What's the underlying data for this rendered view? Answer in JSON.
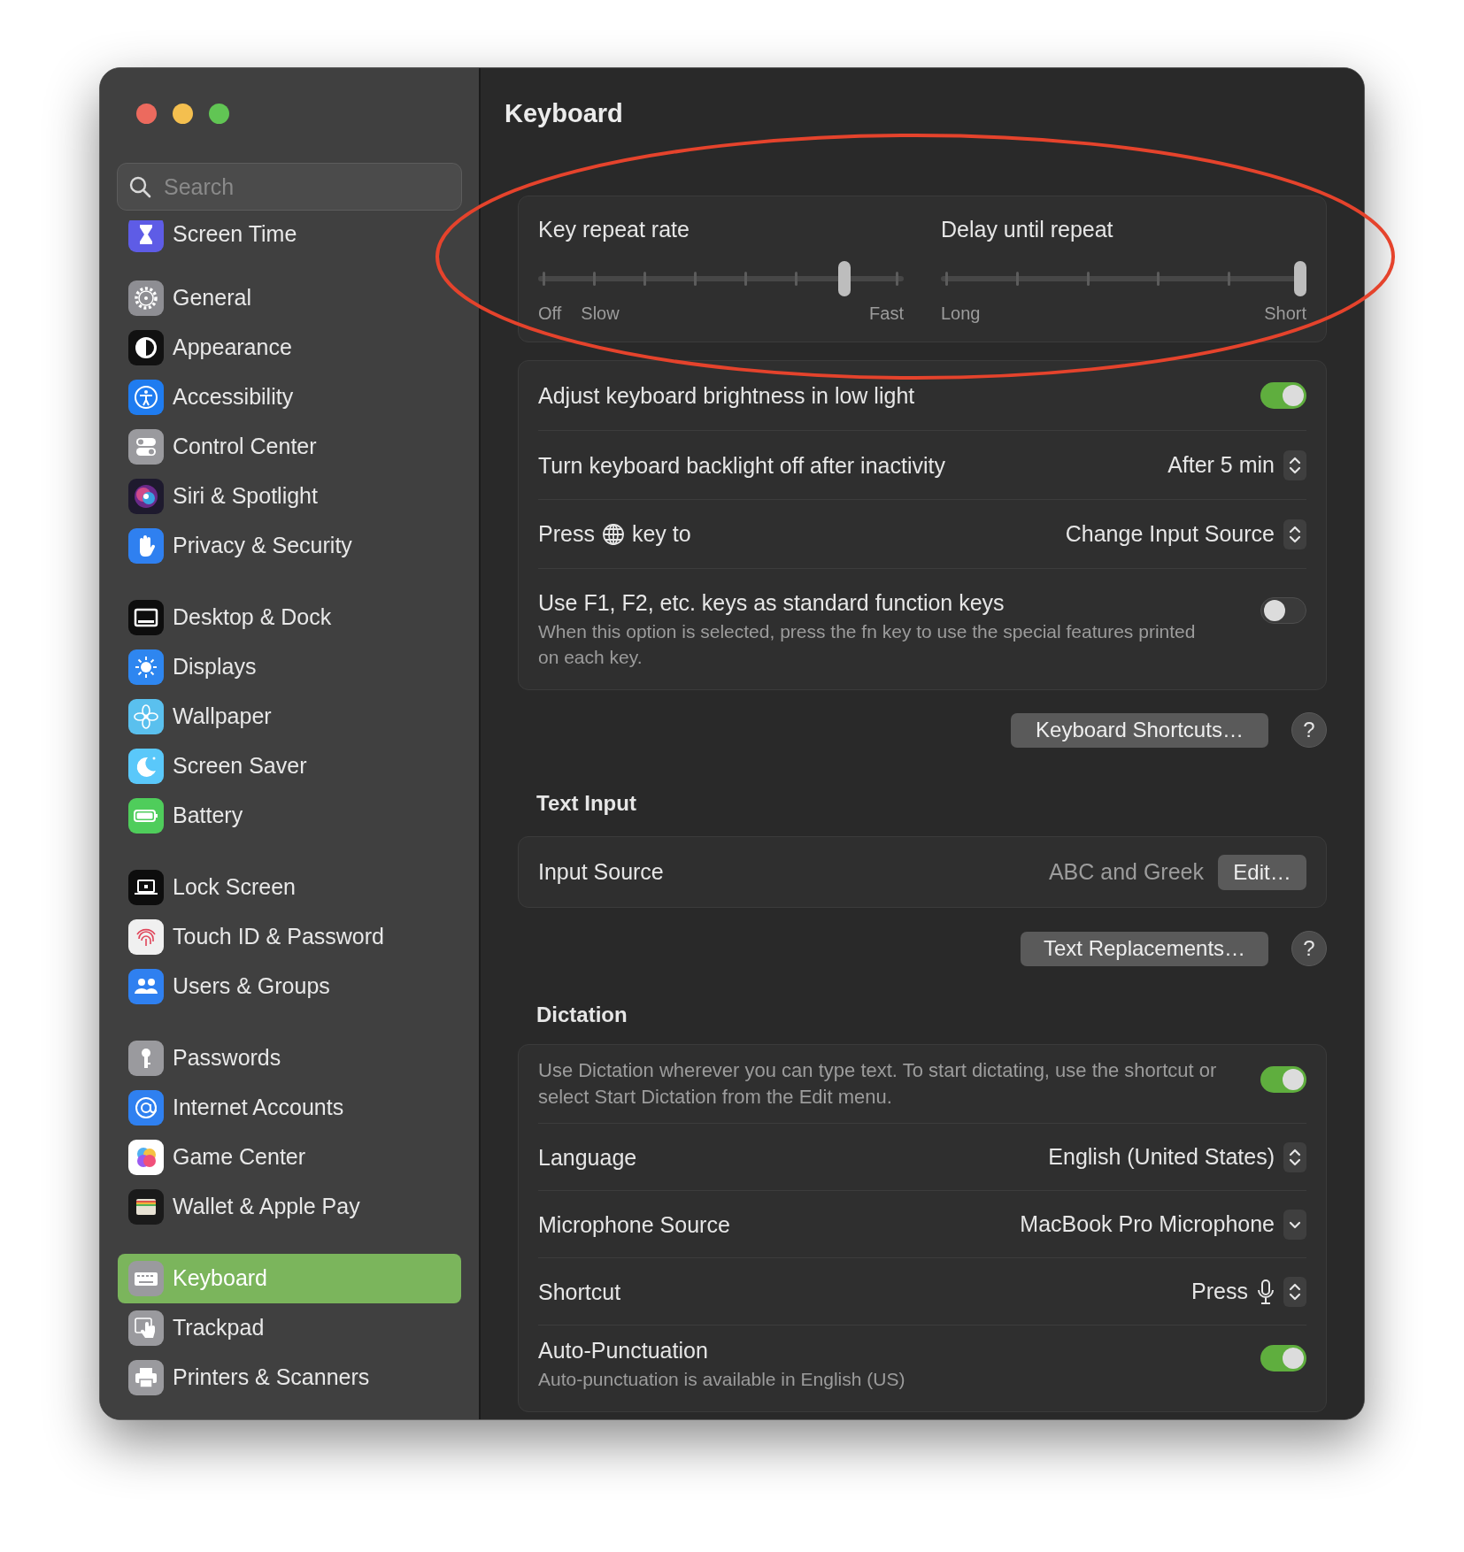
{
  "window": {
    "title": "Keyboard"
  },
  "sidebar": {
    "search": {
      "placeholder": "Search"
    },
    "groups": [
      {
        "items": [
          {
            "label": "Screen Time",
            "selected": false
          }
        ]
      },
      {
        "items": [
          {
            "label": "General",
            "selected": false
          },
          {
            "label": "Appearance",
            "selected": false
          },
          {
            "label": "Accessibility",
            "selected": false
          },
          {
            "label": "Control Center",
            "selected": false
          },
          {
            "label": "Siri & Spotlight",
            "selected": false
          },
          {
            "label": "Privacy & Security",
            "selected": false
          }
        ]
      },
      {
        "items": [
          {
            "label": "Desktop & Dock",
            "selected": false
          },
          {
            "label": "Displays",
            "selected": false
          },
          {
            "label": "Wallpaper",
            "selected": false
          },
          {
            "label": "Screen Saver",
            "selected": false
          },
          {
            "label": "Battery",
            "selected": false
          }
        ]
      },
      {
        "items": [
          {
            "label": "Lock Screen",
            "selected": false
          },
          {
            "label": "Touch ID & Password",
            "selected": false
          },
          {
            "label": "Users & Groups",
            "selected": false
          }
        ]
      },
      {
        "items": [
          {
            "label": "Passwords",
            "selected": false
          },
          {
            "label": "Internet Accounts",
            "selected": false
          },
          {
            "label": "Game Center",
            "selected": false
          },
          {
            "label": "Wallet & Apple Pay",
            "selected": false
          }
        ]
      },
      {
        "items": [
          {
            "label": "Keyboard",
            "selected": true
          },
          {
            "label": "Trackpad",
            "selected": false
          },
          {
            "label": "Printers & Scanners",
            "selected": false
          }
        ]
      }
    ]
  },
  "sliders": [
    {
      "label": "Key repeat rate",
      "level": 0.85,
      "marks": [
        "Off",
        "Slow",
        "Fast"
      ]
    },
    {
      "label": "Delay until repeat",
      "level": 1,
      "marks": [
        "Long",
        "Short"
      ]
    }
  ],
  "keyboard_settings": [
    {
      "kind": "toggle",
      "label": "Adjust keyboard brightness in low light",
      "on": true
    },
    {
      "kind": "popup",
      "label": "Turn keyboard backlight off after inactivity",
      "value": "After 5 min"
    },
    {
      "kind": "globe-popup",
      "label_before": "Press",
      "label_after": "key to",
      "value": "Change Input Source"
    },
    {
      "kind": "toggle",
      "label": "Use F1, F2, etc. keys as standard function keys",
      "note": "When this option is selected, press the fn key to use the special features printed on each key.",
      "on": false
    }
  ],
  "keyboard_buttons": {
    "shortcuts": "Keyboard Shortcuts…",
    "help": "?"
  },
  "text_input": {
    "heading": "Text Input",
    "rows": [
      {
        "label": "Input Source",
        "value": "ABC and Greek",
        "button": "Edit…"
      }
    ],
    "button": "Text Replacements…",
    "help": "?"
  },
  "dictation": {
    "heading": "Dictation",
    "rows": [
      {
        "kind": "toggle",
        "note": "Use Dictation wherever you can type text. To start dictating, use the shortcut or select Start Dictation from the Edit menu.",
        "on": true
      },
      {
        "kind": "popup",
        "label": "Language",
        "value": "English (United States)"
      },
      {
        "kind": "dropdown",
        "label": "Microphone Source",
        "value": "MacBook Pro Microphone"
      },
      {
        "kind": "mic-popup",
        "label": "Shortcut",
        "value": "Press"
      },
      {
        "kind": "toggle",
        "label": "Auto-Punctuation",
        "note": "Auto-punctuation is available in English (US)",
        "on": true
      }
    ]
  },
  "annotation": {
    "kind": "ellipse"
  }
}
